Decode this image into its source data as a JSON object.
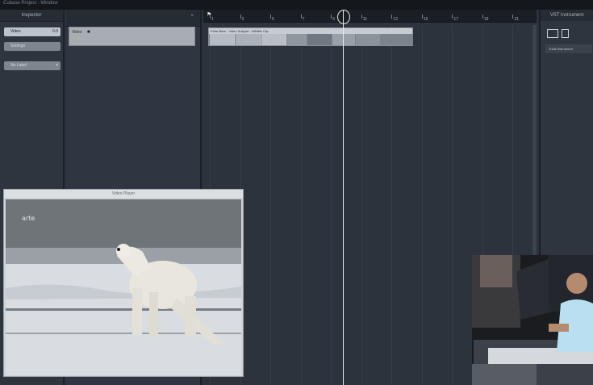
{
  "titlebar": {
    "text": "Cubase Project - Window"
  },
  "inspector": {
    "title": "Inspector",
    "rows": [
      {
        "label": "Video",
        "value": "0.0"
      },
      {
        "label": "Settings",
        "value": ""
      },
      {
        "label": "No Label",
        "value": ""
      }
    ]
  },
  "track": {
    "name": "Video"
  },
  "ruler": {
    "ticks": [
      "1",
      "3",
      "5",
      "7",
      "9",
      "11",
      "13",
      "15",
      "17",
      "19",
      "21"
    ]
  },
  "clip": {
    "name": "Polar Bear - Video Snippet - Wildlife Clip"
  },
  "right_panel": {
    "title": "VST Instrument",
    "item": "Track Instrument"
  },
  "video_window": {
    "title": "Video Player",
    "watermark": "arte"
  },
  "colors": {
    "background": "#2b323b",
    "panel": "#2e353f",
    "clip": "#c7ccd2",
    "cursor": "#e6e9ee"
  }
}
